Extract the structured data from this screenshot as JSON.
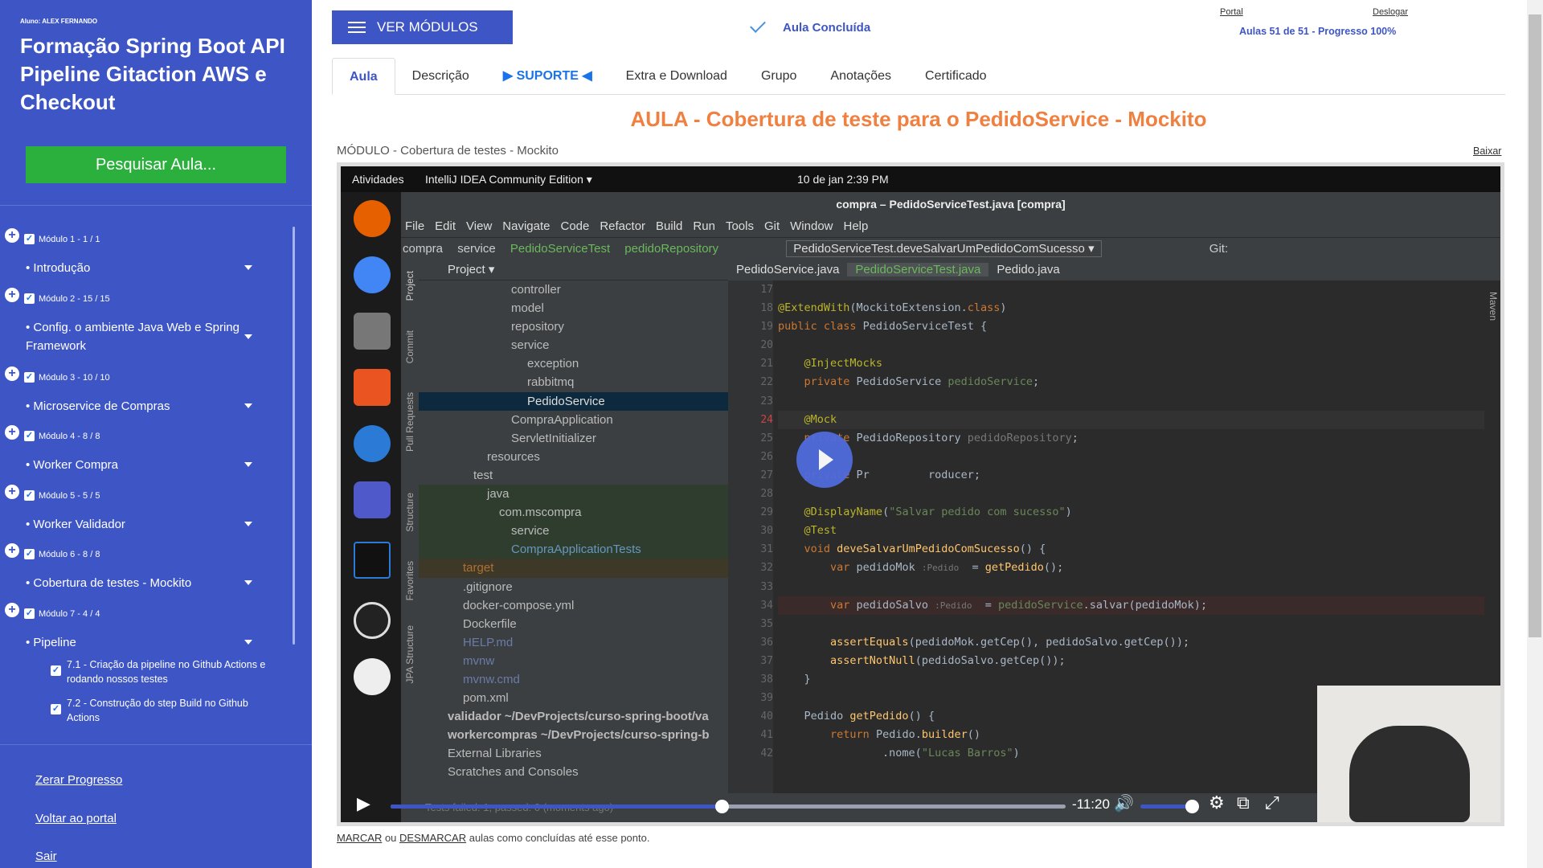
{
  "student": "Aluno: ALEX FERNANDO",
  "course_title": "Formação Spring Boot API Pipeline Gitaction AWS e Checkout",
  "search_btn": "Pesquisar Aula...",
  "modules": [
    {
      "header": "Módulo 1 - 1 / 1",
      "lesson": "• Introdução"
    },
    {
      "header": "Módulo 2 - 15 / 15",
      "lesson": "• Config. o ambiente Java Web e Spring Framework"
    },
    {
      "header": "Módulo 3 - 10 / 10",
      "lesson": "• Microservice de Compras"
    },
    {
      "header": "Módulo 4 - 8 / 8",
      "lesson": "• Worker Compra"
    },
    {
      "header": "Módulo 5 - 5 / 5",
      "lesson": "• Worker Validador"
    },
    {
      "header": "Módulo 6 - 8 / 8",
      "lesson": "• Cobertura de testes - Mockito"
    },
    {
      "header": "Módulo 7 - 4 / 4",
      "lesson": "• Pipeline"
    }
  ],
  "lessons": [
    "7.1 - Criação da pipeline no Github Actions e rodando nossos testes",
    "7.2 - Construção do step Build no Github Actions"
  ],
  "links": {
    "zerar": "Zerar Progresso",
    "voltar": "Voltar ao portal",
    "sair": "Sair"
  },
  "topbar": {
    "ver_modulos": "VER MÓDULOS",
    "aula_concluida": "Aula Concluída",
    "portal": "Portal",
    "deslogar": "Deslogar",
    "progress": "Aulas 51 de 51 - Progresso 100%"
  },
  "tabs": [
    "Aula",
    "Descrição",
    "▶ SUPORTE ◀",
    "Extra e Download",
    "Grupo",
    "Anotações",
    "Certificado"
  ],
  "lesson_title": "AULA - Cobertura de teste para o PedidoService - Mockito",
  "module_name": "MÓDULO - Cobertura de testes - Mockito",
  "baixar": "Baixar",
  "footer": {
    "marcar": "MARCAR",
    "ou": " ou ",
    "desmarcar": "DESMARCAR",
    "rest": " aulas como concluídas até esse ponto."
  },
  "video": {
    "gnome": {
      "atividades": "Atividades",
      "app": "IntelliJ IDEA Community Edition ▾",
      "clock": "10 de jan  2:39 PM"
    },
    "ide_title": "compra – PedidoServiceTest.java [compra]",
    "menu": [
      "File",
      "Edit",
      "View",
      "Navigate",
      "Code",
      "Refactor",
      "Build",
      "Run",
      "Tools",
      "Git",
      "Window",
      "Help"
    ],
    "nav": [
      "compra",
      "service",
      "PedidoServiceTest",
      "pedidoRepository"
    ],
    "run_config": "PedidoServiceTest.deveSalvarUmPedidoComSucesso ▾",
    "git_label": "Git:",
    "project_label": "Project ▾",
    "tree": [
      "controller",
      "model",
      "repository",
      "service",
      "exception",
      "rabbitmq",
      "PedidoService",
      "CompraApplication",
      "ServletInitializer",
      "resources",
      "test",
      "java",
      "com.mscompra",
      "service",
      "CompraApplicationTests",
      "target",
      ".gitignore",
      "docker-compose.yml",
      "Dockerfile",
      "HELP.md",
      "mvnw",
      "mvnw.cmd",
      "pom.xml",
      "validador ~/DevProjects/curso-spring-boot/va",
      "workercompras ~/DevProjects/curso-spring-b",
      "External Libraries",
      "Scratches and Consoles"
    ],
    "editor_tabs": [
      "PedidoService.java",
      "PedidoServiceTest.java",
      "Pedido.java"
    ],
    "side_labels": [
      "Project",
      "Commit",
      "Pull Requests",
      "Structure",
      "Favorites",
      "JPA Structure"
    ],
    "maven": "Maven",
    "lines": [
      "17",
      "18",
      "19",
      "20",
      "21",
      "22",
      "23",
      "24",
      "25",
      "26",
      "27",
      "28",
      "29",
      "30",
      "31",
      "32",
      "33",
      "34",
      "35",
      "36",
      "37",
      "38",
      "39",
      "40",
      "41",
      "42"
    ],
    "status": "Tests failed: 1, passed: 0 (moments ago)",
    "time": "-11:20",
    "progress": 0.49,
    "volume": 1.0
  },
  "colors": {
    "sidebar": "#3d55c5",
    "accent": "#f08040",
    "green": "#2bb03d"
  }
}
